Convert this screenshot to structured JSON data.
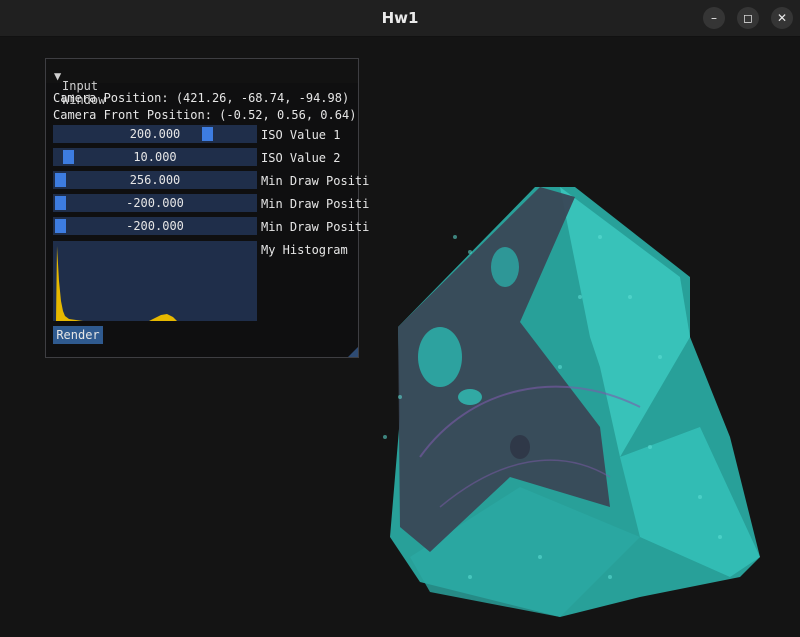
{
  "window": {
    "title": "Hw1"
  },
  "panel": {
    "title": "Input Window",
    "camera_position": "Camera Position: (421.26, -68.74, -94.98)",
    "camera_front": "Camera Front Position: (-0.52, 0.56, 0.64)",
    "sliders": [
      {
        "value": "200.000",
        "label": "ISO Value 1",
        "level": 0.78
      },
      {
        "value": "10.000",
        "label": "ISO Value 2",
        "level": 0.04
      },
      {
        "value": "256.000",
        "label": "Min Draw Positi",
        "level": 0.0
      },
      {
        "value": "-200.000",
        "label": "Min Draw Positi",
        "level": 0.0
      },
      {
        "value": "-200.000",
        "label": "Min Draw Positi",
        "level": 0.0
      }
    ],
    "histogram_label": "My Histogram",
    "histogram_color": "#e6b800",
    "render_button": "Render"
  },
  "colors": {
    "accent": "#3d7ce0",
    "frame": "#1f2e4a",
    "volume": "#2bbfb5"
  }
}
